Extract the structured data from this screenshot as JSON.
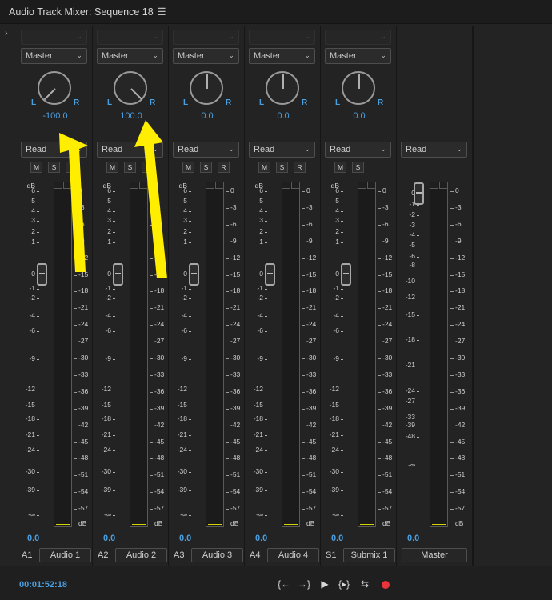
{
  "window": {
    "title": "Audio Track Mixer: Sequence 18",
    "menu_icon": "hamburger-menu-icon"
  },
  "expand_icon": "chevron-right-icon",
  "tracks": [
    {
      "id": "A1",
      "name": "Audio 1",
      "output": "Master",
      "pan": "-100.0",
      "pan_angle": -135,
      "mode": "Read",
      "fader_value": "0.0",
      "buttons": [
        "M",
        "S",
        "R"
      ]
    },
    {
      "id": "A2",
      "name": "Audio 2",
      "output": "Master",
      "pan": "100.0",
      "pan_angle": 135,
      "mode": "Read",
      "fader_value": "0.0",
      "buttons": [
        "M",
        "S",
        "R"
      ]
    },
    {
      "id": "A3",
      "name": "Audio 3",
      "output": "Master",
      "pan": "0.0",
      "pan_angle": 0,
      "mode": "Read",
      "fader_value": "0.0",
      "buttons": [
        "M",
        "S",
        "R"
      ]
    },
    {
      "id": "A4",
      "name": "Audio 4",
      "output": "Master",
      "pan": "0.0",
      "pan_angle": 0,
      "mode": "Read",
      "fader_value": "0.0",
      "buttons": [
        "M",
        "S",
        "R"
      ]
    },
    {
      "id": "S1",
      "name": "Submix 1",
      "output": "Master",
      "pan": "0.0",
      "pan_angle": 0,
      "mode": "Read",
      "fader_value": "0.0",
      "buttons": [
        "M",
        "S"
      ]
    }
  ],
  "master": {
    "name": "Master",
    "mode": "Read",
    "fader_value": "0.0"
  },
  "labels": {
    "L": "L",
    "R": "R",
    "dB": "dB"
  },
  "fader_scale": [
    "6",
    "5",
    "4",
    "3",
    "2",
    "1",
    "0",
    "-1",
    "-2",
    "-4",
    "-6",
    "-9",
    "-12",
    "-15",
    "-18",
    "-21",
    "-24",
    "-30",
    "-39",
    "-∞"
  ],
  "master_fader_scale": [
    "0",
    "-1",
    "-2",
    "-3",
    "-4",
    "-5",
    "-6",
    "-8",
    "-10",
    "-12",
    "-15",
    "-18",
    "-21",
    "-24",
    "-27",
    "-33",
    "-39",
    "-48",
    "-∞"
  ],
  "meter_scale": [
    "0",
    "-3",
    "-6",
    "-9",
    "-12",
    "-15",
    "-18",
    "-21",
    "-24",
    "-27",
    "-30",
    "-33",
    "-36",
    "-39",
    "-42",
    "-45",
    "-48",
    "-51",
    "-54",
    "-57"
  ],
  "meter_unit": "dB",
  "transport": {
    "timecode": "00:01:52:18",
    "buttons": [
      "go-to-in-point-icon",
      "go-to-out-point-icon",
      "play-icon",
      "play-in-to-out-icon",
      "loop-icon",
      "record-icon"
    ]
  },
  "colors": {
    "accent": "#4a9fe0",
    "meter_level": "#d8d400",
    "record": "#e8343a",
    "annotation_arrow": "#ffee00"
  }
}
